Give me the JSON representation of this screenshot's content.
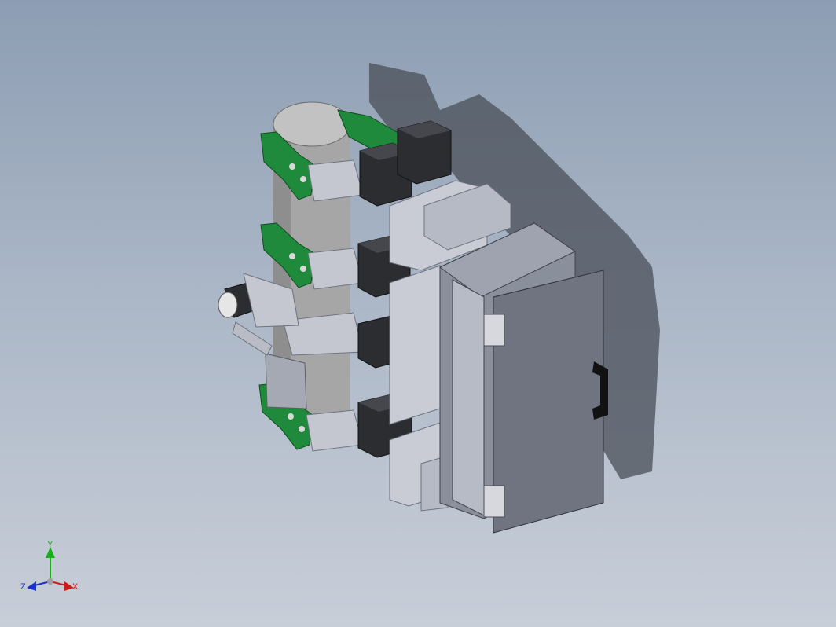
{
  "viewport": {
    "background_top": "#8d9db3",
    "background_bottom": "#c8ced8"
  },
  "model": {
    "colors": {
      "clamp_green": "#1f8a3c",
      "motor_black": "#2b2d31",
      "pipe_gray": "#a9a9a9",
      "frame_light": "#c9ccd4",
      "cabinet": "#8a8f9c",
      "cabinet_door": "#6f7480",
      "shadow": "#4a4f58"
    }
  },
  "triad": {
    "x_label": "X",
    "y_label": "Y",
    "z_label": "Z",
    "x_color": "#d01818",
    "y_color": "#18b018",
    "z_color": "#1830d0"
  }
}
